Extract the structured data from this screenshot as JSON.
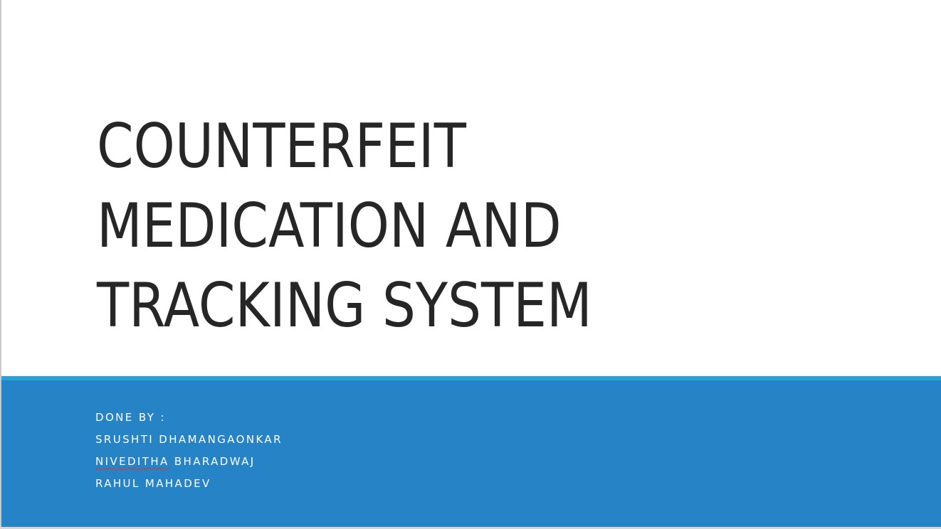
{
  "slide": {
    "title_lines": [
      "COUNTERFEIT",
      "MEDICATION AND",
      "TRACKING SYSTEM"
    ],
    "subtitle": {
      "heading": "DONE BY :",
      "authors": [
        {
          "first": "SRUSHTI",
          "last": "DHAMANGAONKAR"
        },
        {
          "first": "NIVEDITHA",
          "last": "BHARADWAJ"
        },
        {
          "first": "RAHUL",
          "last": "MAHADEV"
        }
      ]
    }
  },
  "colors": {
    "background": "#ffffff",
    "title_text": "#262626",
    "accent_line": "#2aa0d8",
    "footer_band": "#2683c6",
    "subtitle_text": "#ffffff",
    "spellcheck_underline": "#e0312e"
  }
}
